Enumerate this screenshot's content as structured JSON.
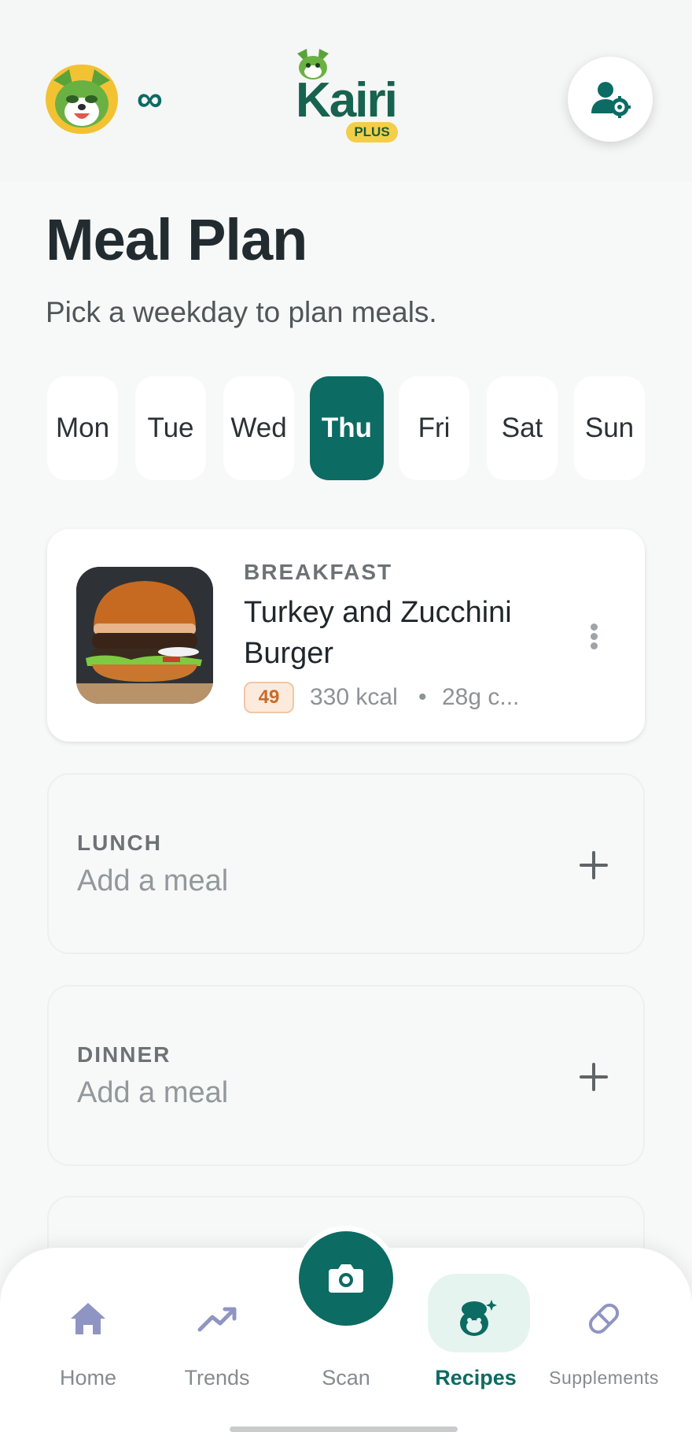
{
  "header": {
    "streak_symbol": "∞",
    "logo_word": "Kairi",
    "logo_badge": "PLUS"
  },
  "page": {
    "title": "Meal Plan",
    "subtitle": "Pick a weekday to plan meals."
  },
  "days": [
    {
      "label": "Mon",
      "active": false
    },
    {
      "label": "Tue",
      "active": false
    },
    {
      "label": "Wed",
      "active": false
    },
    {
      "label": "Thu",
      "active": true
    },
    {
      "label": "Fri",
      "active": false
    },
    {
      "label": "Sat",
      "active": false
    },
    {
      "label": "Sun",
      "active": false
    }
  ],
  "meals": {
    "breakfast": {
      "type": "BREAKFAST",
      "name": "Turkey and Zucchini Burger",
      "score": "49",
      "kcal": "330 kcal",
      "separator": "•",
      "macro": "28g c..."
    },
    "lunch": {
      "type": "LUNCH",
      "placeholder": "Add a meal"
    },
    "dinner": {
      "type": "DINNER",
      "placeholder": "Add a meal"
    }
  },
  "nav": {
    "home": "Home",
    "trends": "Trends",
    "scan": "Scan",
    "recipes": "Recipes",
    "supplements": "Supplements",
    "active": "recipes"
  },
  "colors": {
    "accent": "#0c6b63",
    "score_badge": "#c86a2b",
    "recipes_pill": "#e6f4f0"
  }
}
